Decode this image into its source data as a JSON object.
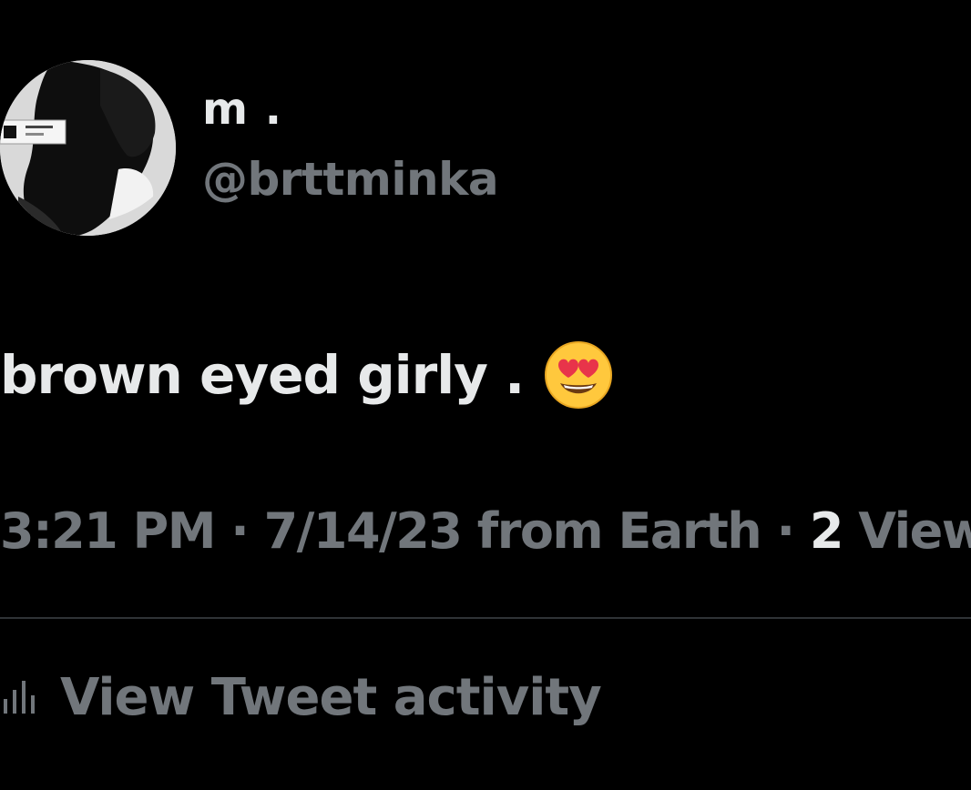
{
  "user": {
    "display_name": "m .",
    "handle": "@brttminka"
  },
  "tweet": {
    "text": "brown eyed girly .",
    "emoji": "smiling-face-with-heart-eyes"
  },
  "meta": {
    "time": "3:21 PM",
    "separator": "·",
    "date": "7/14/23",
    "source": "from Earth",
    "views_count": "2",
    "views_label": "View"
  },
  "activity": {
    "icon": "bar-chart-icon",
    "label": "View Tweet activity"
  },
  "colors": {
    "background": "#000000",
    "primary_text": "#e7e9ea",
    "secondary_text": "#71767b",
    "divider": "#2f3336"
  }
}
